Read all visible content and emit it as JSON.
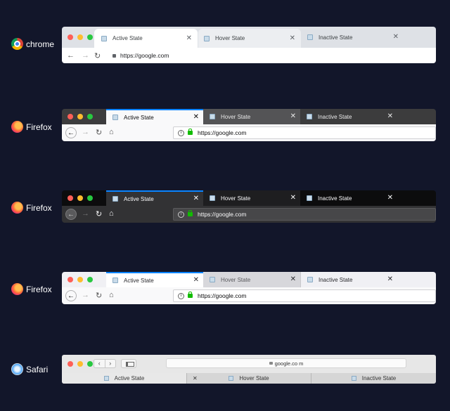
{
  "chrome": {
    "brand": "chrome",
    "tabs": [
      {
        "label": "Active State",
        "state": "active"
      },
      {
        "label": "Hover State",
        "state": "hover"
      },
      {
        "label": "Inactive State",
        "state": "inactive"
      }
    ],
    "close_glyph": "✕",
    "url": "https://google.com"
  },
  "firefox_light": {
    "brand": "Firefox",
    "tabs": [
      {
        "label": "Active State",
        "state": "active"
      },
      {
        "label": "Hover State",
        "state": "hover"
      },
      {
        "label": "Inactive State",
        "state": "inactive"
      }
    ],
    "close_glyph": "✕",
    "url": "https://google.com"
  },
  "firefox_dark": {
    "brand": "Firefox",
    "tabs": [
      {
        "label": "Active State",
        "state": "active"
      },
      {
        "label": "Hover State",
        "state": "hover"
      },
      {
        "label": "Inactive State",
        "state": "inactive"
      }
    ],
    "close_glyph": "✕",
    "url": "https://google.com"
  },
  "firefox_white": {
    "brand": "Firefox",
    "tabs": [
      {
        "label": "Active State",
        "state": "active"
      },
      {
        "label": "Hover State",
        "state": "hover"
      },
      {
        "label": "Inactive State",
        "state": "inactive"
      }
    ],
    "close_glyph": "✕",
    "url": "https://google.com"
  },
  "safari": {
    "brand": "Safari",
    "address": "google.co m",
    "tabs": [
      {
        "label": "Active State",
        "state": "active"
      },
      {
        "label": "Hover State",
        "state": "hover"
      },
      {
        "label": "Inactive State",
        "state": "inactive"
      }
    ],
    "close_glyph": "✕"
  },
  "icons": {
    "back": "←",
    "forward": "→",
    "reload": "↻",
    "home": "⌂",
    "info": "i",
    "chevron_left": "‹",
    "chevron_right": "›"
  },
  "colors": {
    "background": "#12162a",
    "close_red": "#fe5f57",
    "minimize_yellow": "#febc2e",
    "zoom_green": "#28c840",
    "firefox_accent": "#0a84ff",
    "secure_green": "#12bc00"
  }
}
